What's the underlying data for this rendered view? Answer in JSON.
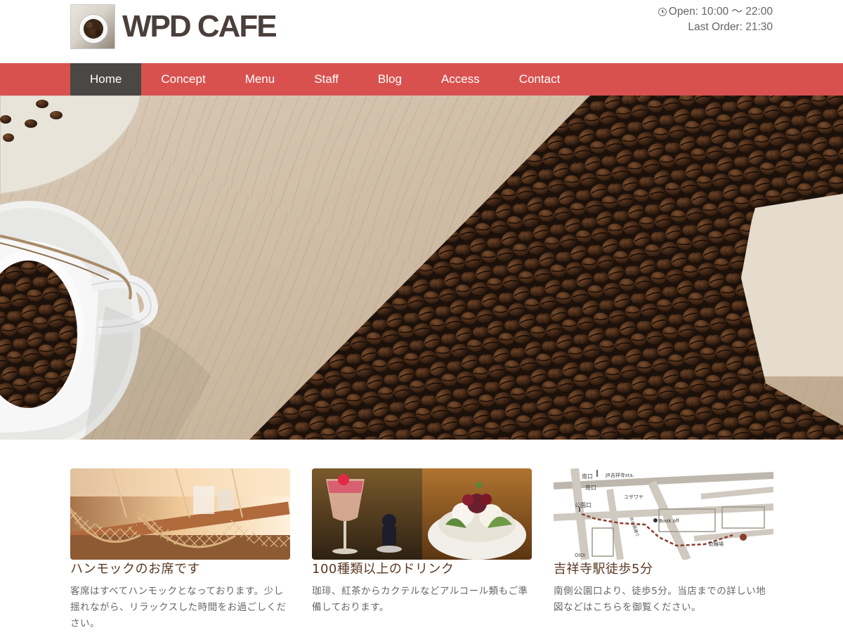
{
  "header": {
    "logo_text": "WPD CAFE",
    "logo_icon": "coffee-cup-beans-icon",
    "hours_open": "Open: 10:00 〜 22:00",
    "hours_last_order": "Last Order: 21:30"
  },
  "nav": {
    "items": [
      {
        "label": "Home",
        "active": true
      },
      {
        "label": "Concept",
        "active": false
      },
      {
        "label": "Menu",
        "active": false
      },
      {
        "label": "Staff",
        "active": false
      },
      {
        "label": "Blog",
        "active": false
      },
      {
        "label": "Access",
        "active": false
      },
      {
        "label": "Contact",
        "active": false
      }
    ]
  },
  "map_labels": {
    "south_exit": "南口",
    "station": "JR吉祥寺sta.",
    "park_exit": "公園口",
    "yuzawaya": "ユザワヤ",
    "bookoff": "Book off",
    "parking": "駐輪場",
    "street": "井の頭通り",
    "marui": "OIOI"
  },
  "cards": [
    {
      "title": "ハンモックのお席です",
      "text": "客席はすべてハンモックとなっております。少し揺れながら、リラックスした時間をお過ごしください。"
    },
    {
      "title": "100種類以上のドリンク",
      "text": "珈琲、紅茶からカクテルなどアルコール類もご準備しております。"
    },
    {
      "title": "吉祥寺駅徒歩5分",
      "text": "南側公園口より、徒歩5分。当店までの詳しい地図などはこちらを御覧ください。"
    }
  ],
  "colors": {
    "nav_bg": "#d9514e",
    "nav_active_bg": "#4a4745",
    "title_brown": "#5a3922"
  }
}
